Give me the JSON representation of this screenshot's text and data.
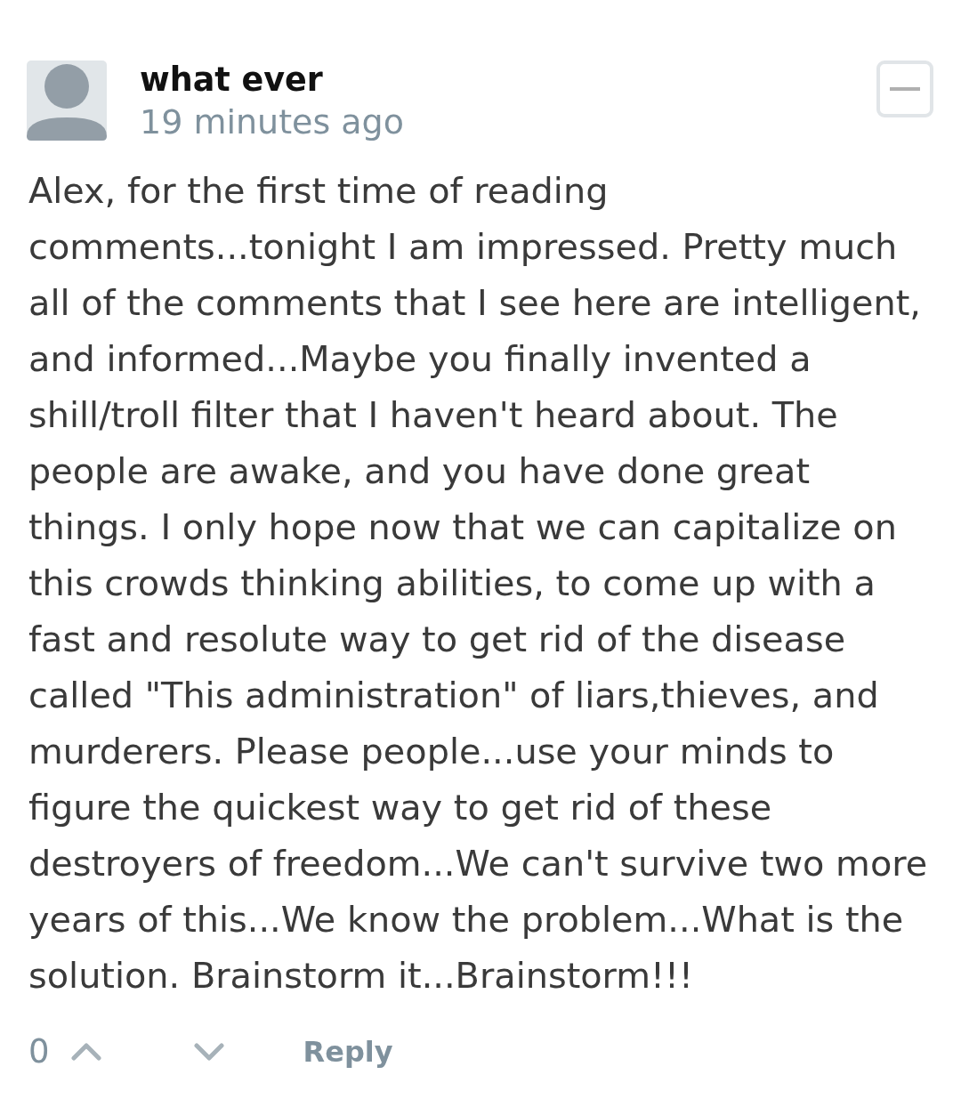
{
  "comment": {
    "author": "what ever",
    "timestamp": "19 minutes ago",
    "expanded": true,
    "body": "Alex, for the first time of reading comments...tonight I am impressed. Pretty much all of the comments that I see here are intelligent, and informed...Maybe you finally invented a shill/troll filter that I haven't heard about. The people are awake, and you have done great things. I only hope now that we can capitalize on this crowds thinking abilities, to come up with a fast and resolute way to get rid of the disease called \"This administration\" of liars,thieves, and murderers. Please people...use your minds to figure the quickest way to get rid of these destroyers of freedom...We can't survive two more years of this...We know the problem...What is the solution. Brainstorm it...Brainstorm!!!",
    "votes": {
      "score": "0"
    },
    "actions": [
      {
        "kind": "reply",
        "label": "Reply"
      }
    ]
  }
}
